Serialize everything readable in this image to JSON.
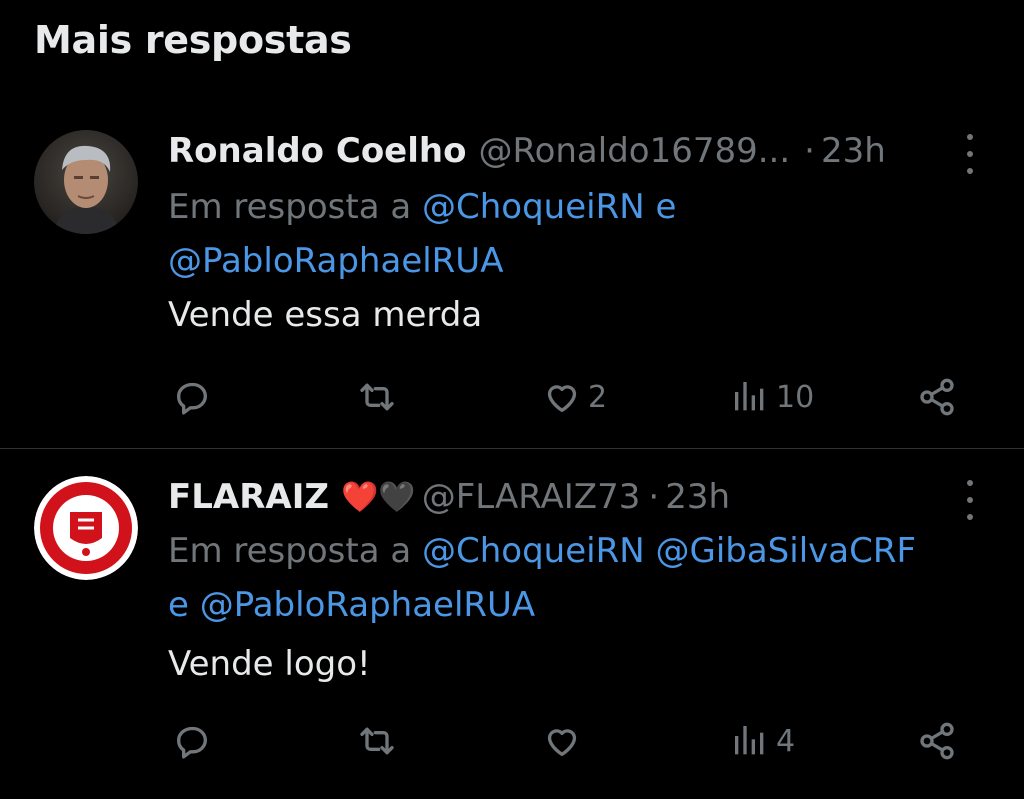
{
  "section_title": "Mais respostas",
  "colors": {
    "background": "#000000",
    "text": "#e7e9ea",
    "muted": "#71767b",
    "link": "#4b97e6",
    "divider": "#2f3336",
    "heart": "#f91880"
  },
  "replies": [
    {
      "display_name": "Ronaldo Coelho",
      "handle": "@Ronaldo16789...",
      "separator": "·",
      "time": "23h",
      "reply_prefix": "Em resposta a ",
      "mentions": [
        "@ChoqueiRN",
        "@PabloRaphaelRUA"
      ],
      "joiner": " e ",
      "text": "Vende essa merda",
      "likes": "2",
      "views": "10",
      "avatar_icon": "user-photo-avatar"
    },
    {
      "display_name": "FLARAIZ",
      "name_emoji": "❤️🖤",
      "handle": "@FLARAIZ73",
      "separator": "·",
      "time": "23h",
      "reply_prefix": "Em resposta a ",
      "mentions": [
        "@ChoqueiRN",
        "@GibaSilvaCRF",
        "@PabloRaphaelRUA"
      ],
      "joiner": "e ",
      "text": "Vende logo!",
      "likes": "",
      "views": "4",
      "avatar_icon": "club-logo-avatar"
    }
  ],
  "icons": [
    "reply-icon",
    "retweet-icon",
    "like-icon",
    "views-icon",
    "share-icon",
    "more-options-icon"
  ]
}
